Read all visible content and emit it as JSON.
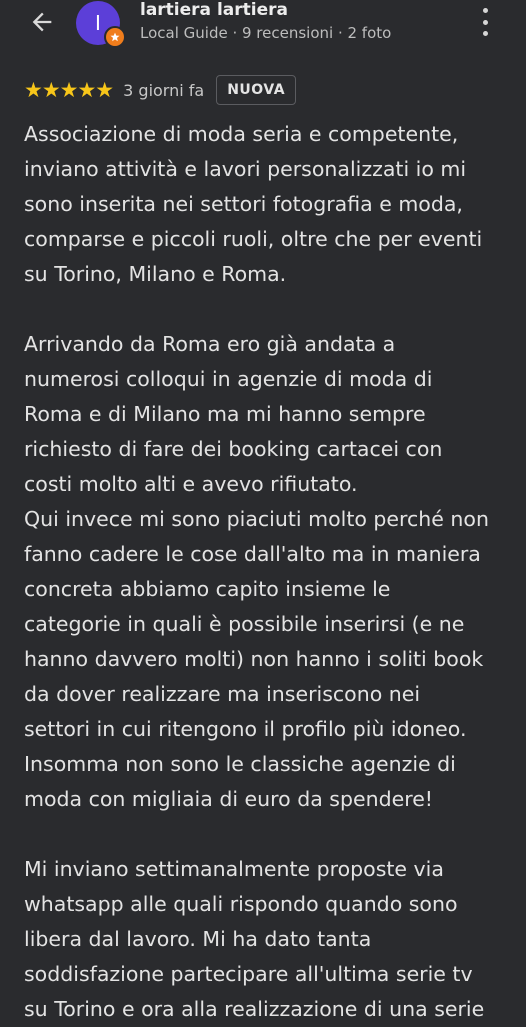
{
  "header": {
    "avatar_initial": "I",
    "user_name": "lartiera lartiera",
    "user_meta": "Local Guide · 9 recensioni · 2 foto"
  },
  "review": {
    "stars": "★★★★★",
    "rating": 5,
    "time": "3 giorni fa",
    "badge": "NUOVA",
    "lines": [
      "Associazione di moda seria e competente,",
      "inviano attività e lavori personalizzati io mi",
      "sono inserita nei settori fotografia e moda,",
      "comparse e piccoli ruoli, oltre che per eventi",
      "su Torino, Milano e Roma.",
      "",
      "Arrivando da Roma ero già andata a",
      "numerosi colloqui in agenzie di moda di",
      "Roma e di Milano ma mi hanno sempre",
      "richiesto di fare dei booking cartacei con",
      "costi molto alti e avevo rifiutato.",
      "Qui invece mi sono piaciuti molto perché non",
      "fanno cadere le cose dall'alto ma in maniera",
      "concreta abbiamo capito insieme le",
      "categorie in quali è possibile inserirsi (e ne",
      "hanno davvero molti) non hanno i soliti book",
      "da dover realizzare ma inseriscono nei",
      "settori in cui ritengono il profilo più idoneo.",
      "Insomma non sono le classiche agenzie di",
      "moda con migliaia di euro da spendere!",
      "",
      "Mi inviano settimanalmente proposte via",
      "whatsapp alle quali rispondo quando sono",
      "libera dal lavoro. Mi ha dato tanta",
      "soddisfazione partecipare all'ultima serie tv",
      "su Torino e ora alla realizzazione di una serie"
    ]
  },
  "colors": {
    "background": "#2a2b2e",
    "star": "#f7c61a",
    "avatar": "#5c3fd8",
    "local_guide_badge": "#f07d1c"
  }
}
